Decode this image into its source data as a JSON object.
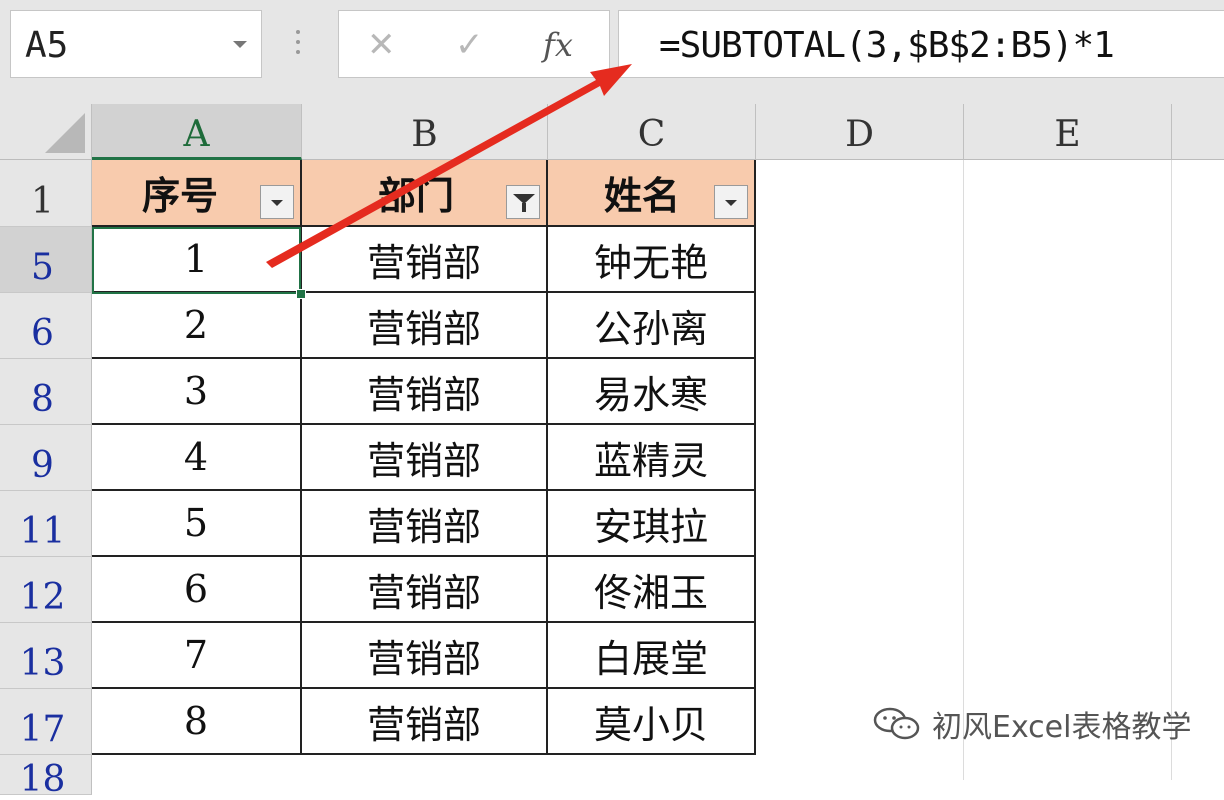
{
  "name_box": {
    "value": "A5"
  },
  "formula_bar": {
    "cancel_icon": "close-icon",
    "enter_icon": "checkmark-icon",
    "fx_label": "fx",
    "formula": "=SUBTOTAL(3,$B$2:B5)*1"
  },
  "columns": [
    "A",
    "B",
    "C",
    "D",
    "E"
  ],
  "selected_cell": "A5",
  "table": {
    "headers": [
      "序号",
      "部门",
      "姓名"
    ],
    "filter_active_column": "部门",
    "rows": [
      {
        "row_num": "5",
        "cells": [
          "1",
          "营销部",
          "钟无艳"
        ]
      },
      {
        "row_num": "6",
        "cells": [
          "2",
          "营销部",
          "公孙离"
        ]
      },
      {
        "row_num": "8",
        "cells": [
          "3",
          "营销部",
          "易水寒"
        ]
      },
      {
        "row_num": "9",
        "cells": [
          "4",
          "营销部",
          "蓝精灵"
        ]
      },
      {
        "row_num": "11",
        "cells": [
          "5",
          "营销部",
          "安琪拉"
        ]
      },
      {
        "row_num": "12",
        "cells": [
          "6",
          "营销部",
          "佟湘玉"
        ]
      },
      {
        "row_num": "13",
        "cells": [
          "7",
          "营销部",
          "白展堂"
        ]
      },
      {
        "row_num": "17",
        "cells": [
          "8",
          "营销部",
          "莫小贝"
        ]
      }
    ],
    "header_row_num": "1",
    "partial_row_num": "18"
  },
  "colors": {
    "header_fill": "#f8cbad",
    "selection": "#217346",
    "row_number_color": "#1a2fa0",
    "annotation_arrow": "#e52b1f"
  },
  "watermark": {
    "text": "初风Excel表格教学",
    "icon": "wechat-icon"
  }
}
